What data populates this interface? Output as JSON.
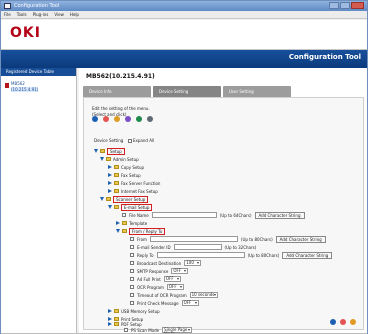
{
  "window": {
    "title": "Configuration Tool"
  },
  "menu": [
    "File",
    "Tools",
    "Plug-ins",
    "View",
    "Help"
  ],
  "logo": "OKI",
  "brand": "Configuration Tool",
  "sidebar": {
    "title": "Registered Device Table",
    "device": {
      "name": "MB562",
      "ip": "(10.215.4.91)"
    }
  },
  "device_title": "MB562(10.215.4.91)",
  "tabs": [
    {
      "label": "Device Info"
    },
    {
      "label": "Device Setting"
    },
    {
      "label": "User Setting"
    }
  ],
  "panel": {
    "description1": "Edit the setting of the menu.",
    "description2": "(Select and click)"
  },
  "navigation": {
    "label": "Device Setting",
    "expand_all": "Expand All"
  },
  "tree": [
    {
      "label": "Setup",
      "expanded": true,
      "highlighted": true
    },
    {
      "label": "Admin Setup",
      "expanded": true,
      "highlighted": false
    },
    {
      "label": "Copy Setup",
      "expanded": false,
      "highlighted": false
    },
    {
      "label": "Fax Setup",
      "expanded": false,
      "highlighted": false
    },
    {
      "label": "Fax Server Function",
      "expanded": false,
      "highlighted": false
    },
    {
      "label": "Internet Fax Setup",
      "expanded": false,
      "highlighted": false
    },
    {
      "label": "Scanner Setup",
      "expanded": true,
      "highlighted": true
    },
    {
      "label": "E-mail Setup",
      "expanded": true,
      "highlighted": true
    },
    {
      "label": "Template",
      "expanded": false,
      "highlighted": false
    },
    {
      "label": "From / Reply To",
      "expanded": true,
      "highlighted": true
    },
    {
      "label": "USB Memory Setup",
      "expanded": false,
      "highlighted": false
    },
    {
      "label": "Print Setup",
      "expanded": false,
      "highlighted": false
    },
    {
      "label": "PDF Setup",
      "expanded": false,
      "highlighted": false
    }
  ],
  "fields": [
    {
      "label": "File Name",
      "helper": "(Up to 64Chars)",
      "button": "Add Character String"
    },
    {
      "label": "From",
      "helper": "(Up to 80Chars)",
      "button": "Add Character String"
    },
    {
      "label": "E-mail Sender ID",
      "helper": "(Up to 32Chars)",
      "button": ""
    },
    {
      "label": "Reply To",
      "helper": "(Up to 80Chars)",
      "button": "Add Character String"
    }
  ],
  "settings": [
    {
      "label": "Broadcast Destination",
      "value": "100"
    },
    {
      "label": "SMTP Response",
      "value": "OFF"
    },
    {
      "label": "A4 Full Print",
      "value": "OFF"
    },
    {
      "label": "OCR Program",
      "value": "OFF"
    },
    {
      "label": "Timeout of OCR Program",
      "value": "10 seconds"
    },
    {
      "label": "Print Check Message",
      "value": "OFF"
    }
  ],
  "print_mode": {
    "label": "PS Scan Mode",
    "value": "Single Page Mode"
  },
  "icons": [
    "computer-icon",
    "shield-icon",
    "user-icon",
    "help-icon",
    "folder-icon",
    "settings-icon",
    "reload-icon",
    "warning-icon",
    "info-icon"
  ]
}
